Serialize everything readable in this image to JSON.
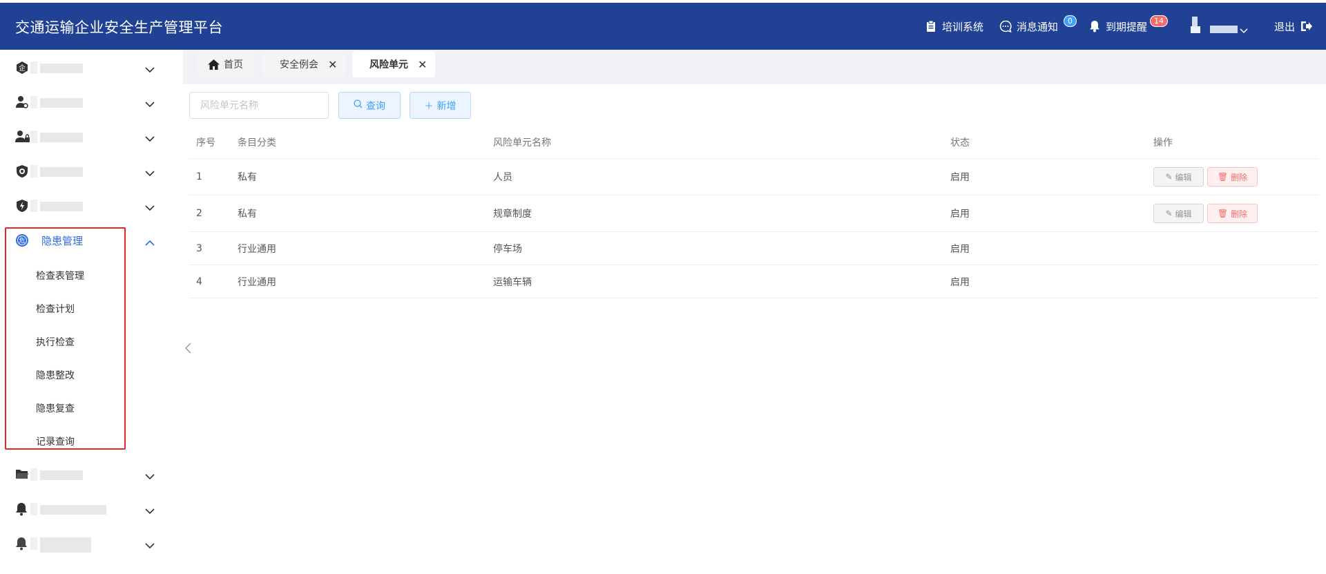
{
  "header": {
    "title": "交通运输企业安全生产管理平台",
    "training_label": "培训系统",
    "messages_label": "消息通知",
    "messages_count": "0",
    "expiry_label": "到期提醒",
    "expiry_count": "14",
    "logout_label": "退出",
    "bg_color": "#214294"
  },
  "sidebar": {
    "active_menu": {
      "label": "隐患管理",
      "icon_char": "危",
      "items": [
        "检查表管理",
        "检查计划",
        "执行检查",
        "隐患整改",
        "隐患复查",
        "记录查询"
      ]
    },
    "accent_color": "#2d6ae0"
  },
  "tabs": [
    {
      "label": "首页"
    },
    {
      "label": "安全例会"
    },
    {
      "label": "风险单元"
    }
  ],
  "toolbar": {
    "search_placeholder": "风险单元名称",
    "search_value": "",
    "query_label": "查询",
    "add_label": "新增"
  },
  "table": {
    "columns": [
      "序号",
      "条目分类",
      "风险单元名称",
      "状态",
      "操作"
    ],
    "rows": [
      {
        "index": "1",
        "category": "私有",
        "name": "人员",
        "status": "启用",
        "edit": "编辑",
        "delete": "删除"
      },
      {
        "index": "2",
        "category": "私有",
        "name": "规章制度",
        "status": "启用",
        "edit": "编辑",
        "delete": "删除"
      },
      {
        "index": "3",
        "category": "行业通用",
        "name": "停车场",
        "status": "启用"
      },
      {
        "index": "4",
        "category": "行业通用",
        "name": "运输车辆",
        "status": "启用"
      }
    ]
  }
}
